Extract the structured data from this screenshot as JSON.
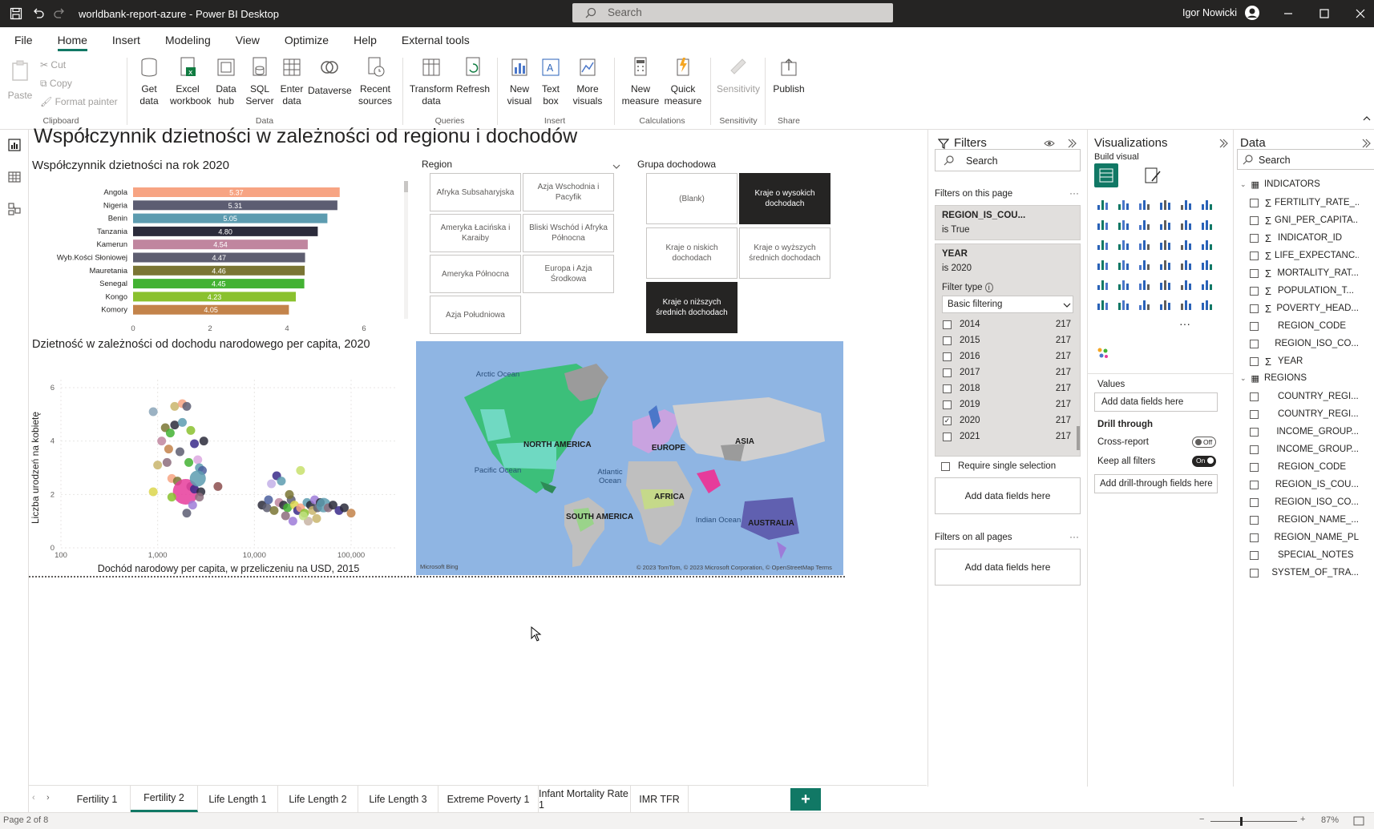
{
  "app": {
    "title": "worldbank-report-azure - Power BI Desktop",
    "search_placeholder": "Search",
    "user": "Igor Nowicki"
  },
  "menu": [
    "File",
    "Home",
    "Insert",
    "Modeling",
    "View",
    "Optimize",
    "Help",
    "External tools"
  ],
  "ribbon": {
    "clipboard": {
      "paste": "Paste",
      "cut": "Cut",
      "copy": "Copy",
      "format_painter": "Format painter",
      "group": "Clipboard"
    },
    "data": {
      "get_data": "Get data",
      "excel": "Excel workbook",
      "data_hub": "Data hub",
      "sql": "SQL Server",
      "enter": "Enter data",
      "dataverse": "Dataverse",
      "recent": "Recent sources",
      "group": "Data"
    },
    "queries": {
      "transform": "Transform data",
      "refresh": "Refresh",
      "group": "Queries"
    },
    "insert": {
      "new_visual": "New visual",
      "text_box": "Text box",
      "more_visuals": "More visuals",
      "group": "Insert"
    },
    "calc": {
      "new_measure": "New measure",
      "quick_measure": "Quick measure",
      "group": "Calculations"
    },
    "sensitivity": {
      "label": "Sensitivity",
      "group": "Sensitivity"
    },
    "share": {
      "publish": "Publish",
      "group": "Share"
    }
  },
  "report": {
    "title": "Współczynnik dzietności w zależności od regionu i dochodów",
    "bar_title": "Współczynnik dzietności na rok 2020",
    "scatter_title": "Dzietność w zależności od dochodu narodowego per capita, 2020",
    "region_slicer": {
      "title": "Region",
      "items": [
        "Afryka Subsaharyjska",
        "Azja Wschodnia i Pacyfik",
        "Ameryka Łacińska i Karaiby",
        "Bliski Wschód i Afryka Północna",
        "Ameryka Północna",
        "Europa i Azja Środkowa",
        "Azja Południowa"
      ]
    },
    "income_slicer": {
      "title": "Grupa dochodowa",
      "items": [
        "(Blank)",
        "Kraje o wysokich dochodach",
        "Kraje o niskich dochodach",
        "Kraje o wyższych średnich dochodach",
        "Kraje o niższych średnich dochodach"
      ]
    },
    "map": {
      "labels": [
        "Arctic Ocean",
        "NORTH AMERICA",
        "EUROPE",
        "ASIA",
        "Pacific Ocean",
        "Atlantic Ocean",
        "AFRICA",
        "SOUTH AMERICA",
        "Indian Ocean",
        "AUSTRALIA"
      ],
      "attribution": "© 2023 TomTom, © 2023 Microsoft Corporation, © OpenStreetMap  Terms",
      "bing": "Microsoft Bing"
    }
  },
  "chart_data": [
    {
      "type": "bar",
      "title": "Współczynnik dzietności na rok 2020",
      "categories": [
        "Angola",
        "Nigeria",
        "Benin",
        "Tanzania",
        "Kamerun",
        "Wyb.Kości Słoniowej",
        "Mauretania",
        "Senegal",
        "Kongo",
        "Komory"
      ],
      "values": [
        5.37,
        5.31,
        5.05,
        4.8,
        4.54,
        4.47,
        4.46,
        4.45,
        4.23,
        4.05
      ],
      "value_labels": [
        "5.37",
        "5.31",
        "5.05",
        "4.80",
        "4.54",
        "4.47",
        "4.46",
        "4.45",
        "4.23",
        "4.05"
      ],
      "colors": [
        "#f7a483",
        "#5c5d72",
        "#5d9cb0",
        "#2b2b3b",
        "#c0869f",
        "#5d5d70",
        "#7a7534",
        "#43b233",
        "#8ac12e",
        "#c3834a"
      ],
      "xlim": [
        0,
        6
      ],
      "xticks": [
        "0",
        "2",
        "4",
        "6"
      ]
    },
    {
      "type": "scatter",
      "title": "Dzietność w zależności od dochodu narodowego per capita, 2020",
      "xlabel": "Dochód narodowy per capita, w przeliczeniu na USD, 2015",
      "ylabel": "Liczba urodzeń na kobietę",
      "xscale": "log",
      "xlim": [
        100,
        100000
      ],
      "ylim": [
        0,
        6
      ],
      "xticks": [
        "100",
        "1,000",
        "10,000",
        "100,000"
      ],
      "yticks": [
        "0",
        "2",
        "4",
        "6"
      ],
      "points": [
        {
          "x": 900,
          "y": 5.1,
          "c": "#8aa5b8"
        },
        {
          "x": 1500,
          "y": 5.3,
          "c": "#c9b56c"
        },
        {
          "x": 1800,
          "y": 5.4,
          "c": "#f7a483"
        },
        {
          "x": 2000,
          "y": 5.3,
          "c": "#5c5d72"
        },
        {
          "x": 1200,
          "y": 4.5,
          "c": "#7a7534"
        },
        {
          "x": 1350,
          "y": 4.3,
          "c": "#43b233"
        },
        {
          "x": 1500,
          "y": 4.6,
          "c": "#2b2b3b"
        },
        {
          "x": 1800,
          "y": 4.7,
          "c": "#5d9cb0"
        },
        {
          "x": 2200,
          "y": 4.4,
          "c": "#8ac12e"
        },
        {
          "x": 3000,
          "y": 4.0,
          "c": "#2b2b3b"
        },
        {
          "x": 1100,
          "y": 4.0,
          "c": "#c0869f"
        },
        {
          "x": 1300,
          "y": 3.7,
          "c": "#c3834a"
        },
        {
          "x": 1700,
          "y": 3.6,
          "c": "#5d5d70"
        },
        {
          "x": 2100,
          "y": 3.2,
          "c": "#43b233"
        },
        {
          "x": 2400,
          "y": 3.9,
          "c": "#3a2a8a"
        },
        {
          "x": 2600,
          "y": 3.3,
          "c": "#dca8e0"
        },
        {
          "x": 2700,
          "y": 3.0,
          "c": "#5d9cb0"
        },
        {
          "x": 2900,
          "y": 2.9,
          "c": "#4b5f9d"
        },
        {
          "x": 1000,
          "y": 3.1,
          "c": "#c9b56c"
        },
        {
          "x": 1250,
          "y": 3.2,
          "c": "#8c6c7c"
        },
        {
          "x": 1400,
          "y": 2.6,
          "c": "#f7a483"
        },
        {
          "x": 1600,
          "y": 2.5,
          "c": "#7a7534"
        },
        {
          "x": 2200,
          "y": 2.3,
          "c": "#5c5d72"
        },
        {
          "x": 1950,
          "y": 2.1,
          "c": "#e63c9b",
          "r": 16
        },
        {
          "x": 2400,
          "y": 2.2,
          "c": "#3a2a8a"
        },
        {
          "x": 2800,
          "y": 2.1,
          "c": "#2b2b3b"
        },
        {
          "x": 2600,
          "y": 2.6,
          "c": "#5d9cb0",
          "r": 10
        },
        {
          "x": 900,
          "y": 2.1,
          "c": "#dcd64c"
        },
        {
          "x": 1400,
          "y": 1.9,
          "c": "#8ac12e"
        },
        {
          "x": 2700,
          "y": 1.9,
          "c": "#8c6c7c"
        },
        {
          "x": 4200,
          "y": 2.3,
          "c": "#8c4e4e"
        },
        {
          "x": 2000,
          "y": 1.3,
          "c": "#5c5d72"
        },
        {
          "x": 2300,
          "y": 1.6,
          "c": "#9d7bd8"
        },
        {
          "x": 12000,
          "y": 1.6,
          "c": "#2b2b3b"
        },
        {
          "x": 13500,
          "y": 1.5,
          "c": "#5d5d70"
        },
        {
          "x": 15000,
          "y": 2.4,
          "c": "#c3b0e8"
        },
        {
          "x": 17000,
          "y": 2.7,
          "c": "#3a2a8a"
        },
        {
          "x": 19000,
          "y": 2.5,
          "c": "#5d9cb0"
        },
        {
          "x": 16000,
          "y": 1.4,
          "c": "#7a7534"
        },
        {
          "x": 18000,
          "y": 1.7,
          "c": "#c0869f"
        },
        {
          "x": 20000,
          "y": 1.6,
          "c": "#2b2b3b"
        },
        {
          "x": 22000,
          "y": 1.5,
          "c": "#43b233"
        },
        {
          "x": 24000,
          "y": 1.8,
          "c": "#5c5d72"
        },
        {
          "x": 21000,
          "y": 1.2,
          "c": "#8c6c7c"
        },
        {
          "x": 26000,
          "y": 1.6,
          "c": "#dcd64c"
        },
        {
          "x": 28000,
          "y": 1.4,
          "c": "#3a2a8a"
        },
        {
          "x": 30000,
          "y": 1.5,
          "c": "#f7a483"
        },
        {
          "x": 33000,
          "y": 1.3,
          "c": "#8ac12e"
        },
        {
          "x": 35000,
          "y": 1.7,
          "c": "#5d9cb0"
        },
        {
          "x": 38000,
          "y": 1.6,
          "c": "#2b2b3b"
        },
        {
          "x": 40000,
          "y": 1.4,
          "c": "#c9b56c"
        },
        {
          "x": 42000,
          "y": 1.8,
          "c": "#9d7bd8"
        },
        {
          "x": 45000,
          "y": 1.5,
          "c": "#5d5d70"
        },
        {
          "x": 48000,
          "y": 1.7,
          "c": "#2b2b3b"
        },
        {
          "x": 52000,
          "y": 1.6,
          "c": "#5d9cb0",
          "r": 9
        },
        {
          "x": 58000,
          "y": 1.5,
          "c": "#8c6c7c"
        },
        {
          "x": 65000,
          "y": 1.6,
          "c": "#2b2b3b"
        },
        {
          "x": 75000,
          "y": 1.4,
          "c": "#3a2a8a"
        },
        {
          "x": 85000,
          "y": 1.5,
          "c": "#2b2b3b"
        },
        {
          "x": 100000,
          "y": 1.3,
          "c": "#c3834a"
        },
        {
          "x": 30000,
          "y": 2.9,
          "c": "#c8e06c"
        },
        {
          "x": 36000,
          "y": 1.0,
          "c": "#c8b4a4"
        },
        {
          "x": 32000,
          "y": 1.2,
          "c": "#c0e080"
        },
        {
          "x": 25000,
          "y": 1.0,
          "c": "#9d7bd8"
        },
        {
          "x": 44000,
          "y": 1.1,
          "c": "#c9b56c"
        },
        {
          "x": 14000,
          "y": 1.8,
          "c": "#4b5f9d"
        },
        {
          "x": 23000,
          "y": 2.0,
          "c": "#7a7534"
        }
      ]
    }
  ],
  "filters": {
    "title": "Filters",
    "search": "Search",
    "on_page": "Filters on this page",
    "card1_name": "REGION_IS_COU...",
    "card1_value": "is True",
    "card2_name": "YEAR",
    "card2_value": "is 2020",
    "filter_type_label": "Filter type",
    "filter_type_value": "Basic filtering",
    "years": [
      {
        "year": "2014",
        "count": "217",
        "checked": false
      },
      {
        "year": "2015",
        "count": "217",
        "checked": false
      },
      {
        "year": "2016",
        "count": "217",
        "checked": false
      },
      {
        "year": "2017",
        "count": "217",
        "checked": false
      },
      {
        "year": "2018",
        "count": "217",
        "checked": false
      },
      {
        "year": "2019",
        "count": "217",
        "checked": false
      },
      {
        "year": "2020",
        "count": "217",
        "checked": true
      },
      {
        "year": "2021",
        "count": "217",
        "checked": false
      }
    ],
    "require_single": "Require single selection",
    "add_fields": "Add data fields here",
    "on_all_pages": "Filters on all pages",
    "add_fields_all": "Add data fields here"
  },
  "visualizations": {
    "title": "Visualizations",
    "build_visual": "Build visual",
    "values": "Values",
    "add_fields": "Add data fields here",
    "drill_through": "Drill through",
    "cross_report": "Cross-report",
    "cross_report_state": "Off",
    "keep_all_filters": "Keep all filters",
    "keep_all_filters_state": "On",
    "add_drill": "Add drill-through fields here"
  },
  "data_pane": {
    "title": "Data",
    "search": "Search",
    "tables": [
      {
        "name": "INDICATORS",
        "fields": [
          {
            "name": "FERTILITY_RATE_...",
            "sigma": true
          },
          {
            "name": "GNI_PER_CAPITA...",
            "sigma": true
          },
          {
            "name": "INDICATOR_ID",
            "sigma": true
          },
          {
            "name": "LIFE_EXPECTANC...",
            "sigma": true
          },
          {
            "name": "MORTALITY_RAT...",
            "sigma": true
          },
          {
            "name": "POPULATION_T...",
            "sigma": true
          },
          {
            "name": "POVERTY_HEAD...",
            "sigma": true
          },
          {
            "name": "REGION_CODE",
            "sigma": false
          },
          {
            "name": "REGION_ISO_CO...",
            "sigma": false
          },
          {
            "name": "YEAR",
            "sigma": true
          }
        ]
      },
      {
        "name": "REGIONS",
        "fields": [
          {
            "name": "COUNTRY_REGI...",
            "sigma": false
          },
          {
            "name": "COUNTRY_REGI...",
            "sigma": false
          },
          {
            "name": "INCOME_GROUP...",
            "sigma": false
          },
          {
            "name": "INCOME_GROUP...",
            "sigma": false
          },
          {
            "name": "REGION_CODE",
            "sigma": false
          },
          {
            "name": "REGION_IS_COU...",
            "sigma": false
          },
          {
            "name": "REGION_ISO_CO...",
            "sigma": false
          },
          {
            "name": "REGION_NAME_...",
            "sigma": false
          },
          {
            "name": "REGION_NAME_PL",
            "sigma": false
          },
          {
            "name": "SPECIAL_NOTES",
            "sigma": false
          },
          {
            "name": "SYSTEM_OF_TRA...",
            "sigma": false
          }
        ]
      }
    ]
  },
  "tabs": [
    "Fertility 1",
    "Fertility 2",
    "Life Length 1",
    "Life Length 2",
    "Life Length 3",
    "Extreme Poverty 1",
    "Infant Mortality Rate 1",
    "IMR TFR"
  ],
  "active_tab": 1,
  "status": {
    "page": "Page 2 of 8",
    "zoom": "87%"
  },
  "colors": {
    "accent": "#117865",
    "titlebar": "#252423",
    "selected_chip": "#252423"
  }
}
